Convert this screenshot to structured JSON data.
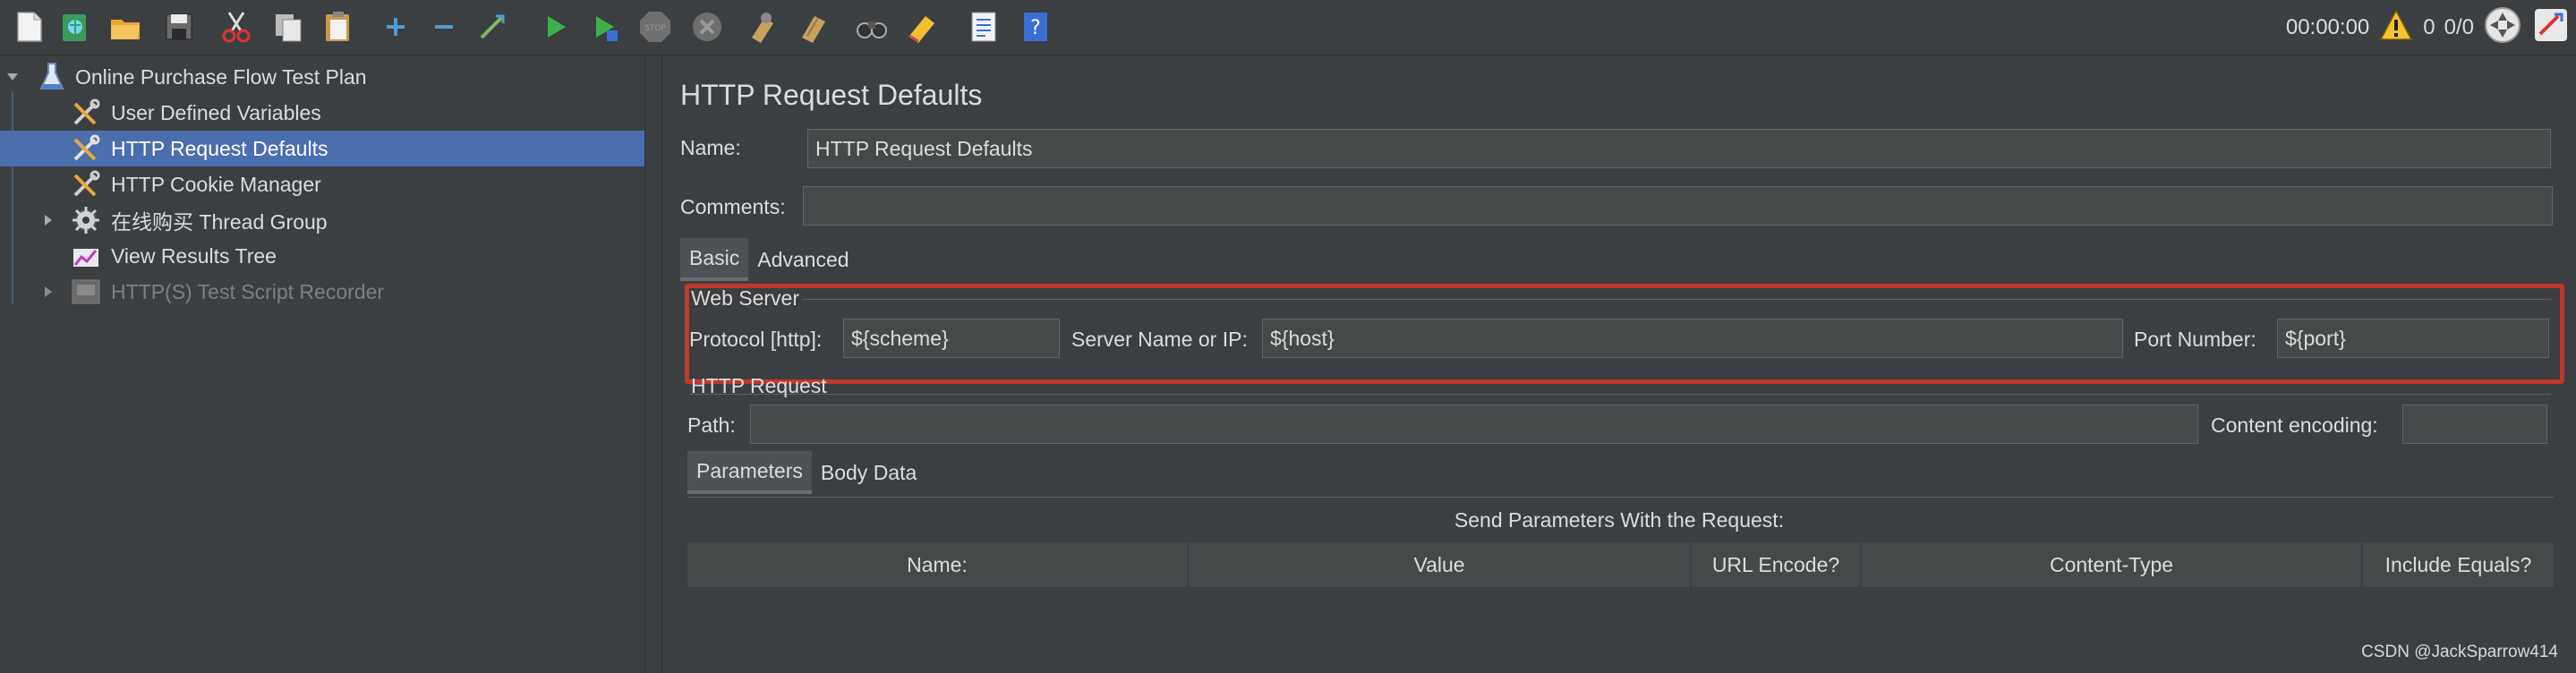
{
  "toolbar": {
    "buttons": [
      {
        "icon": "new-icon"
      },
      {
        "icon": "templates-icon"
      },
      {
        "icon": "open-icon"
      },
      {
        "icon": "save-icon"
      },
      {
        "icon": "cut-icon"
      },
      {
        "icon": "copy-icon"
      },
      {
        "icon": "paste-icon"
      },
      {
        "icon": "expand-icon"
      },
      {
        "icon": "collapse-icon"
      },
      {
        "icon": "toggle-icon"
      },
      {
        "icon": "start-icon"
      },
      {
        "icon": "start-no-pauses-icon"
      },
      {
        "icon": "stop-icon"
      },
      {
        "icon": "shutdown-icon"
      },
      {
        "icon": "clear-icon"
      },
      {
        "icon": "clear-all-icon"
      },
      {
        "icon": "search-icon"
      },
      {
        "icon": "reset-search-icon"
      },
      {
        "icon": "function-helper-icon"
      },
      {
        "icon": "help-icon"
      }
    ],
    "stop_label": "STOP",
    "timer": "00:00:00",
    "warning_count": "0",
    "threads": "0/0"
  },
  "tree": {
    "items": [
      {
        "label": "Online Purchase Flow Test Plan",
        "icon": "test-plan-icon",
        "expanded": true
      },
      {
        "label": "User Defined Variables",
        "icon": "config-element-icon"
      },
      {
        "label": "HTTP Request Defaults",
        "icon": "config-element-icon",
        "selected": true
      },
      {
        "label": "HTTP Cookie Manager",
        "icon": "config-element-icon"
      },
      {
        "label": "在线购买 Thread Group",
        "icon": "thread-group-icon",
        "expanded": false
      },
      {
        "label": "View Results Tree",
        "icon": "listener-icon"
      },
      {
        "label": "HTTP(S) Test Script Recorder",
        "icon": "recorder-icon",
        "disabled": true
      }
    ]
  },
  "panel": {
    "title": "HTTP Request Defaults",
    "name_label": "Name:",
    "name_value": "HTTP Request Defaults",
    "comments_label": "Comments:",
    "comments_value": "",
    "tabs": [
      "Basic",
      "Advanced"
    ],
    "web_server": {
      "legend": "Web Server",
      "protocol_label": "Protocol [http]:",
      "protocol_value": "${scheme}",
      "server_label": "Server Name or IP:",
      "server_value": "${host}",
      "port_label": "Port Number:",
      "port_value": "${port}"
    },
    "http_request": {
      "legend": "HTTP Request",
      "path_label": "Path:",
      "path_value": "",
      "encoding_label": "Content encoding:",
      "encoding_value": ""
    },
    "sub_tabs": [
      "Parameters",
      "Body Data"
    ],
    "params_caption": "Send Parameters With the Request:",
    "columns": [
      "Name:",
      "Value",
      "URL Encode?",
      "Content-Type",
      "Include Equals?"
    ]
  },
  "watermark": "CSDN @JackSparrow414",
  "colors": {
    "selection": "#4b6eaf",
    "highlight": "#c0392b",
    "background": "#3c3f41"
  }
}
